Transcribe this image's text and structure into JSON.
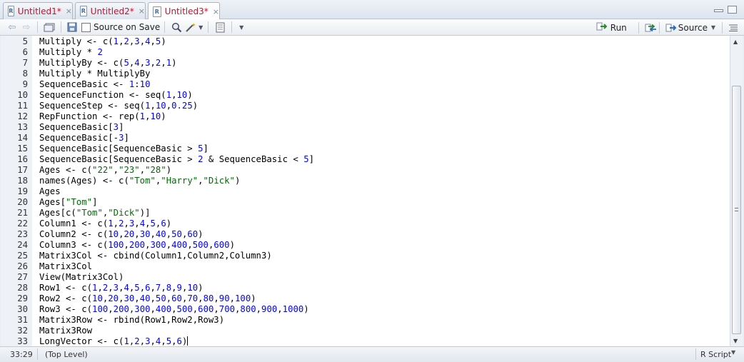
{
  "tabs": [
    {
      "label": "Untitled1*",
      "close": "×",
      "icon": "r-file-icon",
      "active": false
    },
    {
      "label": "Untitled2*",
      "close": "×",
      "icon": "r-file-icon",
      "active": false
    },
    {
      "label": "Untitled3*",
      "close": "×",
      "icon": "r-file-icon",
      "active": true
    }
  ],
  "toolbar": {
    "source_on_save_label": "Source on Save",
    "source_on_save_checked": false,
    "run_label": "Run",
    "source_label": "Source"
  },
  "editor": {
    "lines": [
      {
        "n": "5",
        "text": "Multiply <- c(1,2,3,4,5)"
      },
      {
        "n": "6",
        "text": "Multiply * 2"
      },
      {
        "n": "7",
        "text": "MultiplyBy <- c(5,4,3,2,1)"
      },
      {
        "n": "8",
        "text": "Multiply * MultiplyBy"
      },
      {
        "n": "9",
        "text": "SequenceBasic <- 1:10"
      },
      {
        "n": "10",
        "text": "SequenceFunction <- seq(1,10)"
      },
      {
        "n": "11",
        "text": "SequenceStep <- seq(1,10,0.25)"
      },
      {
        "n": "12",
        "text": "RepFunction <- rep(1,10)"
      },
      {
        "n": "13",
        "text": "SequenceBasic[3]"
      },
      {
        "n": "14",
        "text": "SequenceBasic[-3]"
      },
      {
        "n": "15",
        "text": "SequenceBasic[SequenceBasic > 5]"
      },
      {
        "n": "16",
        "text": "SequenceBasic[SequenceBasic > 2 & SequenceBasic < 5]"
      },
      {
        "n": "17",
        "text": "Ages <- c(\"22\",\"23\",\"28\")"
      },
      {
        "n": "18",
        "text": "names(Ages) <- c(\"Tom\",\"Harry\",\"Dick\")"
      },
      {
        "n": "19",
        "text": "Ages"
      },
      {
        "n": "20",
        "text": "Ages[\"Tom\"]"
      },
      {
        "n": "21",
        "text": "Ages[c(\"Tom\",\"Dick\")]"
      },
      {
        "n": "22",
        "text": "Column1 <- c(1,2,3,4,5,6)"
      },
      {
        "n": "23",
        "text": "Column2 <- c(10,20,30,40,50,60)"
      },
      {
        "n": "24",
        "text": "Column3 <- c(100,200,300,400,500,600)"
      },
      {
        "n": "25",
        "text": "Matrix3Col <- cbind(Column1,Column2,Column3)"
      },
      {
        "n": "26",
        "text": "Matrix3Col"
      },
      {
        "n": "27",
        "text": "View(Matrix3Col)"
      },
      {
        "n": "28",
        "text": "Row1 <- c(1,2,3,4,5,6,7,8,9,10)"
      },
      {
        "n": "29",
        "text": "Row2 <- c(10,20,30,40,50,60,70,80,90,100)"
      },
      {
        "n": "30",
        "text": "Row3 <- c(100,200,300,400,500,600,700,800,900,1000)"
      },
      {
        "n": "31",
        "text": "Matrix3Row <- rbind(Row1,Row2,Row3)"
      },
      {
        "n": "32",
        "text": "Matrix3Row"
      },
      {
        "n": "33",
        "text": "LongVector <- c(1,2,3,4,5,6)"
      }
    ]
  },
  "status": {
    "position": "33:29",
    "scope": "(Top Level)",
    "file_type": "R Script"
  },
  "colors": {
    "number": "#0000ff",
    "string": "#036a07",
    "tab_label": "#c8102e"
  }
}
